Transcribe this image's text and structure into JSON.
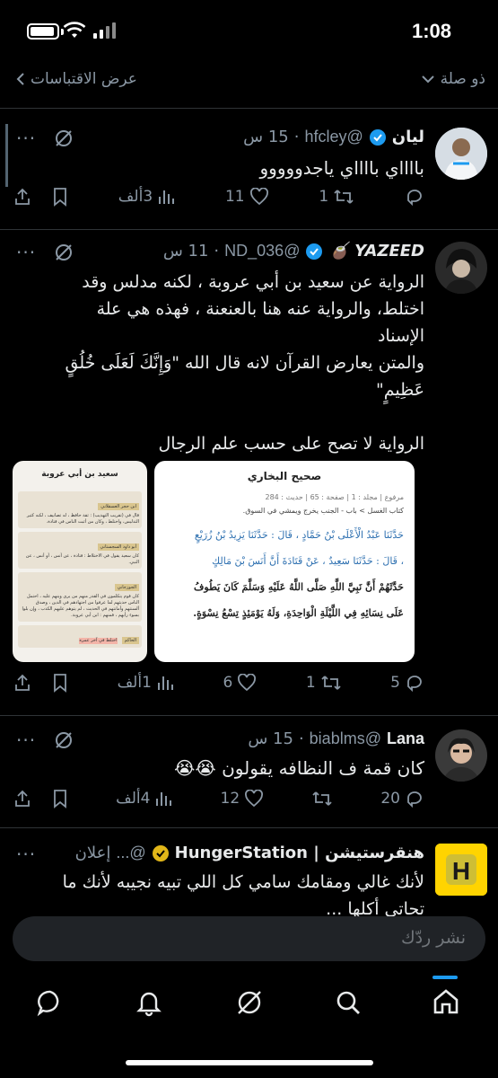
{
  "status": {
    "time": "1:08"
  },
  "subbar": {
    "left_label": "عرض الاقتباسات",
    "right_label": "ذو صلة"
  },
  "posts": [
    {
      "name": "ليان",
      "handle": "@hfcley",
      "time": "15 س",
      "text": "بااااي بااااي ياجدووووو",
      "views": "3ألف",
      "likes": "11",
      "reposts": "1"
    },
    {
      "name": "YAZEED 🧉",
      "handle": "@ND_036",
      "time": "11 س",
      "text_lines": [
        "الرواية عن سعيد بن أبي عروبة ، لكنه مدلس وقد",
        "اختلط، والرواية عنه هنا بالعنعنة ، فهذه هي علة",
        "الإسناد",
        "والمتن يعارض القرآن لانه قال الله \"وَإِنَّكَ لَعَلَى خُلُقٍ",
        "عَظِيمٍ\"",
        "",
        "الرواية لا تصح على حسب علم الرجال"
      ],
      "views": "1ألف",
      "likes": "6",
      "reposts": "1",
      "replies": "5"
    },
    {
      "name": "Lana",
      "handle": "@biablms",
      "time": "15 س",
      "text": "كان قمة ف النظافه يقولون 😭😭",
      "views": "4ألف",
      "likes": "12",
      "replies": "20"
    },
    {
      "name": "هنقرستيشن | HungerStation",
      "handle": "@...",
      "ad_label": "إعلان",
      "text_lines": [
        "لأنك غالي ومقامك سامي كل اللي تبيه نجيبه لأنك ما",
        "تحاتي أكلها ..."
      ]
    }
  ],
  "image_right": {
    "title": "صحيح البخاري",
    "meta": "مرفوع | مجلد : 1 | صفحة : 65 | حديث : 284",
    "chapter": "كتاب الغسل  >  باب - الجنب يخرج ويمشي في السوق.",
    "lines": [
      "حَدَّثَنَا عَبْدُ الْأَعْلَى بْنُ حَمَّادٍ ، قَالَ : حَدَّثَنَا يَزِيدُ بْنُ زُرَيْعٍ",
      "، قَالَ : حَدَّثَنَا سَعِيدٌ ، عَنْ قَتَادَةَ أَنَّ أَنَسَ بْنَ مَالِكٍ",
      "حَدَّثَهُمْ أَنَّ نَبِيَّ اللَّهِ صَلَّى اللَّهُ عَلَيْهِ وَسَلَّمَ كَانَ يَطُوفُ",
      "عَلَى نِسَائِهِ فِي اللَّيْلَةِ الْوَاحِدَةِ، وَلَهُ يَوْمَئِذٍ تِسْعُ نِسْوَةٍ."
    ]
  },
  "image_left": {
    "title": "سعيد بن أبي عروبة",
    "blocks": [
      {
        "tag": "ابن حجر العسقلاني",
        "text": "قال في (تقريب التهذيب) : ثقة حافظ ، له تصانيف ، لكنه كثير التدليس، واختلط ، وكان من أثبت الناس في قتادة."
      },
      {
        "tag": "أبو داود السجستاني",
        "text": "كان سعيد يقول في الاختلاط : قتادة ، عن أنس ، أو أنس ، عن النبي."
      },
      {
        "tag": "الجوزجاني",
        "text": "كان قوم يتكلمون في القدر منهم من يرى وينهم عليه ، احتمل الناس حديثهم لما عرفوا من اجتهادهم في الدين ، وصدق ألسنتهم وأمانتهم في الحديث ، لم يتوهم عليهم الكذب ، وإن بلوا بسوء رأيهم ، فمنهم : ابن أبي عروبة."
      },
      {
        "tag": "الحاكم",
        "text": "اختلط في آخر عمره"
      }
    ]
  },
  "composer": {
    "placeholder": "نشر ردّك"
  }
}
